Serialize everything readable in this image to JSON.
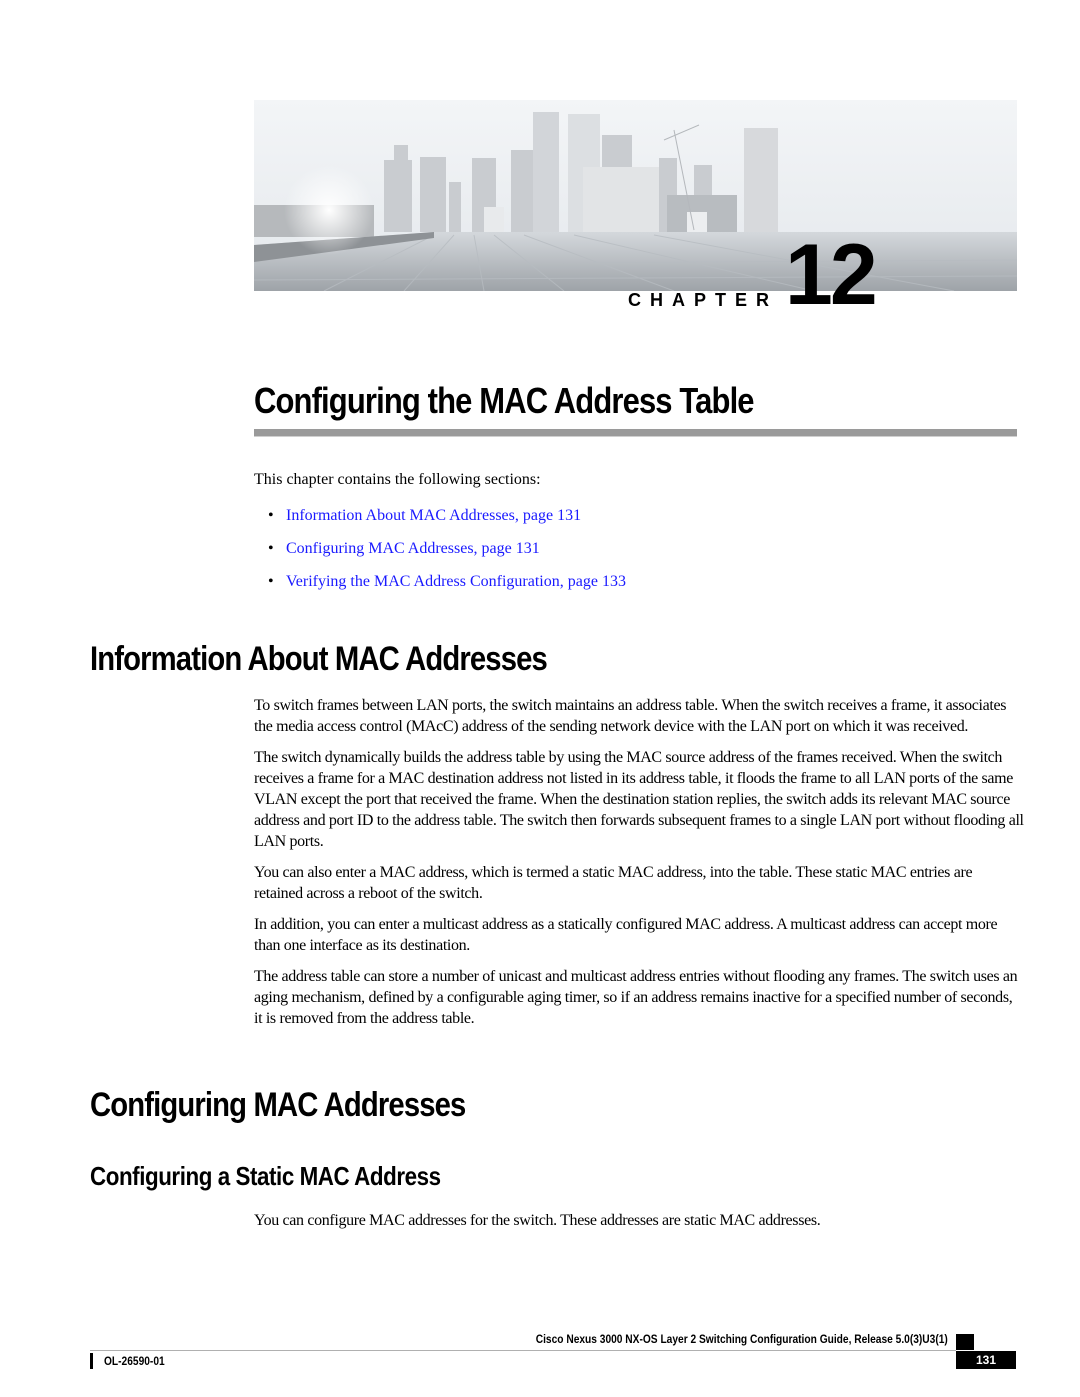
{
  "header": {
    "hero_image_alt": "city skyline with solar-panel rooftop",
    "chapter_label": "CHAPTER",
    "chapter_number": "12"
  },
  "chapter_title": "Configuring the MAC Address Table",
  "intro": "This chapter contains the following sections:",
  "toc": [
    {
      "label": "Information About MAC Addresses,  page  131"
    },
    {
      "label": "Configuring MAC Addresses,  page  131"
    },
    {
      "label": "Verifying the MAC Address Configuration,  page  133"
    }
  ],
  "sections": {
    "info": {
      "heading": "Information About MAC Addresses",
      "paragraphs": [
        "To switch frames between LAN ports, the switch maintains an address table. When the switch receives a frame, it associates the media access control (MAcC) address of the sending network device with the LAN port on which it was received.",
        "The switch dynamically builds the address table by using the MAC source address of the frames received. When the switch receives a frame for a MAC destination address not listed in its address table, it floods the frame to all LAN ports of the same VLAN except the port that received the frame. When the destination station replies, the switch adds its relevant MAC source address and port ID to the address table. The switch then forwards subsequent frames to a single LAN port without flooding all LAN ports.",
        "You can also enter a MAC address, which is termed a static MAC address, into the table. These static MAC entries are retained across a reboot of the switch.",
        "In addition, you can enter a multicast address as a statically configured MAC address. A multicast address can accept more than one interface as its destination.",
        "The address table can store a number of unicast and multicast address entries without flooding any frames. The switch uses an aging mechanism, defined by a configurable aging timer, so if an address remains inactive for a specified number of seconds, it is removed from the address table."
      ]
    },
    "configuring": {
      "heading": "Configuring MAC Addresses",
      "subsection": {
        "heading": "Configuring a Static MAC Address",
        "paragraphs": [
          "You can configure MAC addresses for the switch. These addresses are static MAC addresses."
        ]
      }
    }
  },
  "footer": {
    "guide_title": "Cisco Nexus 3000 NX-OS Layer 2 Switching Configuration Guide, Release 5.0(3)U3(1)",
    "doc_id": "OL-26590-01",
    "page_number": "131"
  },
  "colors": {
    "link": "#1a1aff",
    "rule": "#9a9a9a"
  }
}
